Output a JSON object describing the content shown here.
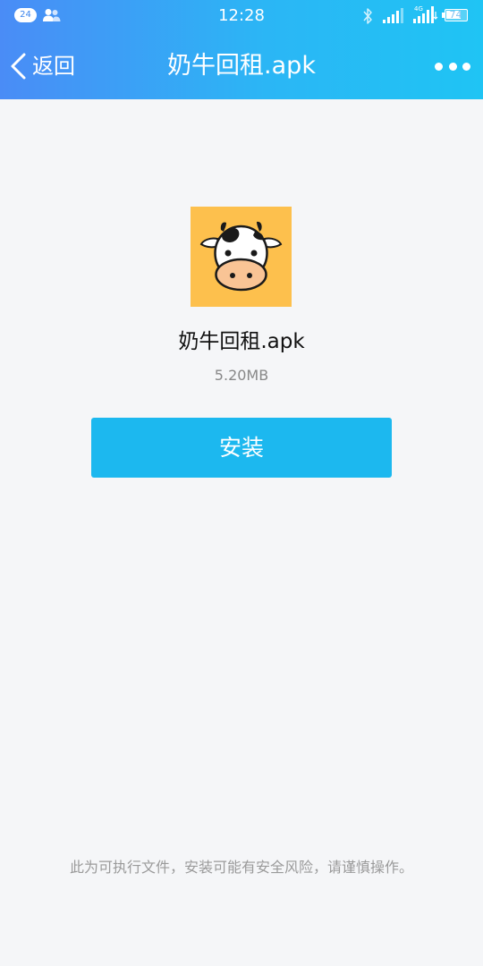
{
  "status_bar": {
    "notification_count": "24",
    "time": "12:28",
    "network_label": "4G",
    "battery_level": "74",
    "battery_percent": 74
  },
  "nav": {
    "back_label": "返回",
    "title": "奶牛回租.apk",
    "more_icon": "more-dots-icon",
    "back_icon": "chevron-left-icon"
  },
  "file": {
    "icon": "cow-app-icon",
    "name": "奶牛回租.apk",
    "size": "5.20MB"
  },
  "actions": {
    "install_label": "安装"
  },
  "footer": {
    "warning": "此为可执行文件，安装可能有安全风险，请谨慎操作。"
  },
  "colors": {
    "header_gradient_start": "#4a8cf6",
    "header_gradient_end": "#1fc4f4",
    "install_button": "#1cb8ef",
    "app_icon_background": "#fdc04d",
    "page_background": "#f5f6f8"
  }
}
